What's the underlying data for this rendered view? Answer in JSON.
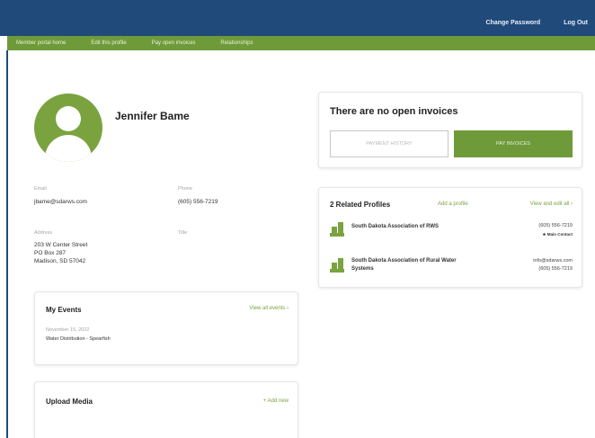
{
  "header": {
    "change_password": "Change Password",
    "log_out": "Log Out"
  },
  "nav": {
    "items": [
      "Member portal home",
      "Edit this profile",
      "Pay open invoices",
      "Relationships"
    ]
  },
  "profile": {
    "name": "Jennifer Bame",
    "email_label": "Email",
    "email": "jbame@sdarws.com",
    "phone_label": "Phone",
    "phone": "(605) 556-7219",
    "address_label": "Address",
    "address_lines": [
      "203 W Center Street",
      "PO Box 287",
      "Madison, SD 57042"
    ],
    "title_label": "Title"
  },
  "events": {
    "title": "My Events",
    "view_all": "View all events ›",
    "date": "November 15, 2022",
    "event_name": "Water Distribution - Spearfish"
  },
  "media": {
    "title": "Upload Media",
    "add_new": "+ Add new"
  },
  "invoices": {
    "title": "There are no open invoices",
    "history_button": "PAYMENT HISTORY",
    "pay_button": "PAY INVOICES"
  },
  "related": {
    "title": "2 Related Profiles",
    "add_profile": "Add a profile",
    "view_edit_all": "View and edit all ›",
    "profiles": [
      {
        "name_lines": [
          "South Dakota Association of RWS"
        ],
        "info_lines": [
          "(605) 556-7219"
        ],
        "badge": "★ Main Contact"
      },
      {
        "name_lines": [
          "South Dakota Association of Rural Water",
          "Systems"
        ],
        "info_lines": [
          "info@sdarws.com",
          "(605) 556-7219"
        ],
        "badge": ""
      }
    ]
  },
  "colors": {
    "header_blue": "#1f4a7a",
    "brand_green": "#6f9a3a",
    "avatar_green": "#7aa33f"
  }
}
